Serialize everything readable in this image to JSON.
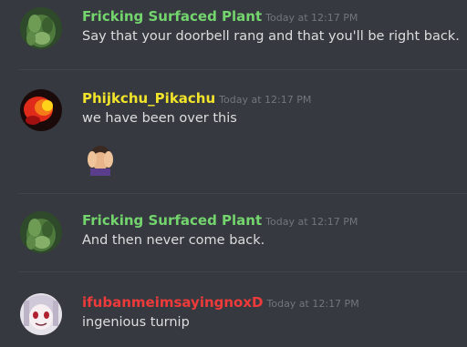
{
  "colors": {
    "background": "#36393f",
    "green_user": "#74d56e",
    "yellow_user": "#f2e42a",
    "red_user": "#ee3a3a",
    "text": "#dcddde",
    "timestamp": "#72767d"
  },
  "messages": [
    {
      "username": "Fricking Surfaced Plant",
      "timestamp": "Today at 12:17 PM",
      "content": "Say that your doorbell rang and that you'll be right back.",
      "avatar_icon": "plant-avatar"
    },
    {
      "username": "Phijkchu_Pikachu",
      "timestamp": "Today at 12:17 PM",
      "content": "we have been over this",
      "avatar_icon": "red-yellow-avatar",
      "emoji_icon": "facepalm-emoji"
    },
    {
      "username": "Fricking Surfaced Plant",
      "timestamp": "Today at 12:17 PM",
      "content": "And then never come back.",
      "avatar_icon": "plant-avatar"
    },
    {
      "username": "ifubanmeimsayingnoxD",
      "timestamp": "Today at 12:17 PM",
      "content": "ingenious turnip",
      "avatar_icon": "anime-girl-avatar"
    }
  ]
}
